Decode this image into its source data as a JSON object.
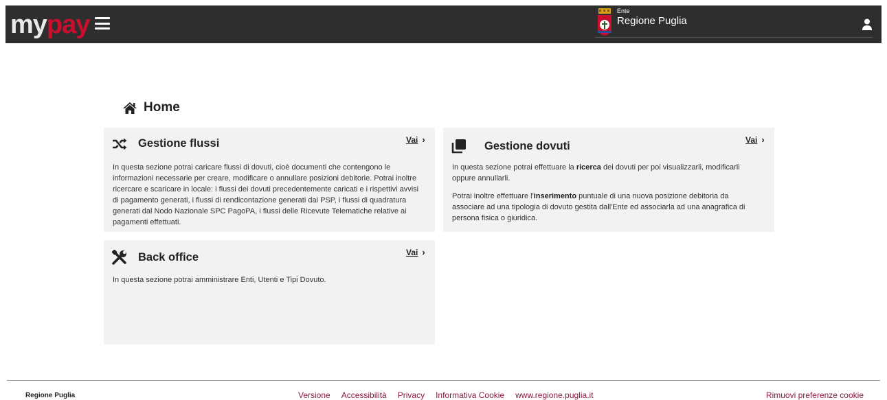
{
  "header": {
    "logo_my": "my",
    "logo_pay": "pay",
    "ente_label": "Ente",
    "ente_name": "Regione Puglia"
  },
  "page": {
    "title": "Home"
  },
  "cards": [
    {
      "title": "Gestione flussi",
      "link": "Vai",
      "paragraphs": [
        "In questa sezione potrai caricare flussi di dovuti, cioè documenti che contengono le informazioni necessarie per creare, modificare o annullare posizioni debitorie. Potrai inoltre ricercare e scaricare in locale: i flussi dei dovuti precedentemente caricati e i rispettivi avvisi di pagamento generati, i flussi di rendicontazione generati dai PSP, i flussi di quadratura generati dal Nodo Nazionale SPC PagoPA, i flussi delle Ricevute Telematiche relative ai pagamenti effettuati."
      ]
    },
    {
      "title": "Gestione dovuti",
      "link": "Vai",
      "p1_pre": "In questa sezione potrai effettuare la ",
      "p1_bold": "ricerca",
      "p1_post": " dei dovuti per poi visualizzarli, modificarli oppure annullarli.",
      "p2_pre": "Potrai inoltre effettuare l'",
      "p2_bold": "inserimento",
      "p2_post": " puntuale di una nuova posizione debitoria da associare ad una tipologia di dovuto gestita dall'Ente ed associarla ad una anagrafica di persona fisica o giuridica."
    },
    {
      "title": "Back office",
      "link": "Vai",
      "paragraphs": [
        "In questa sezione potrai amministrare Enti, Utenti e Tipi Dovuto."
      ]
    }
  ],
  "footer": {
    "org": "Regione Puglia",
    "links": [
      "Versione",
      "Accessibilità",
      "Privacy",
      "Informativa Cookie",
      "www.regione.puglia.it"
    ],
    "remove_cookies": "Rimuovi preferenze cookie"
  },
  "colors": {
    "topbar": "#2e2e2e",
    "brand_red": "#c8102e",
    "card_bg": "#f2f2f2",
    "footer_link": "#8b1a3b"
  }
}
